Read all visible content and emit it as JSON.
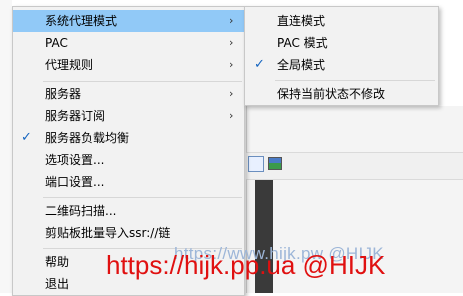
{
  "menu": {
    "items": [
      {
        "label": "系统代理模式",
        "arrow": "›"
      },
      {
        "label": "PAC",
        "arrow": "›"
      },
      {
        "label": "代理规则",
        "arrow": "›"
      },
      {
        "label": "服务器",
        "arrow": "›"
      },
      {
        "label": "服务器订阅",
        "arrow": "›"
      },
      {
        "label": "服务器负载均衡",
        "check": "✓"
      },
      {
        "label": "选项设置..."
      },
      {
        "label": "端口设置..."
      },
      {
        "label": "二维码扫描..."
      },
      {
        "label": "剪贴板批量导入ssr://链"
      },
      {
        "label": "帮助"
      },
      {
        "label": "退出"
      }
    ]
  },
  "submenu": {
    "items": [
      {
        "label": "直连模式"
      },
      {
        "label": "PAC 模式"
      },
      {
        "label": "全局模式",
        "check": "✓"
      },
      {
        "label": "保持当前状态不修改"
      }
    ]
  },
  "watermark": {
    "faint": "https://www.hijk.pw  @HIJK",
    "red": "https://hijk.pp.ua @HIJK"
  },
  "colors": {
    "highlight": "#91c9f7",
    "check": "#1565c0",
    "menu_bg": "#f2f2f2",
    "watermark_red": "#e01010"
  }
}
